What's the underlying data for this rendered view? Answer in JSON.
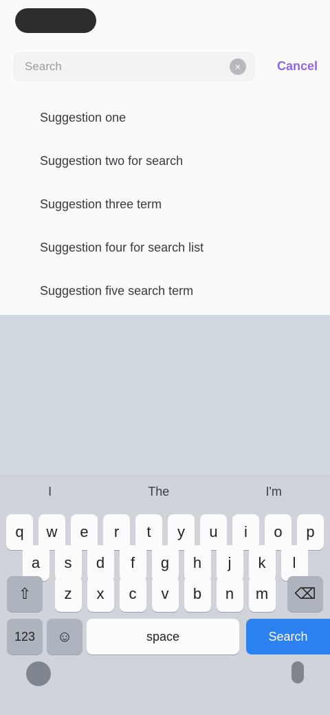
{
  "search": {
    "placeholder": "Search",
    "cancel_label": "Cancel"
  },
  "suggestions": [
    "Suggestion one",
    "Suggestion two for search",
    "Suggestion three term",
    "Suggestion four for search list",
    "Suggestion five search term"
  ],
  "keyboard": {
    "suggestions": [
      "I",
      "The",
      "I'm"
    ],
    "row1": [
      "q",
      "w",
      "e",
      "r",
      "t",
      "y",
      "u",
      "i",
      "o",
      "p"
    ],
    "row2": [
      "a",
      "s",
      "d",
      "f",
      "g",
      "h",
      "j",
      "k",
      "l"
    ],
    "row3": [
      "z",
      "x",
      "c",
      "v",
      "b",
      "n",
      "m"
    ],
    "shift_icon": "shift-icon",
    "backspace_icon": "backspace-icon",
    "number_key": "123",
    "emoji_key": "emoji-icon",
    "space_label": "space",
    "go_label": "Search"
  }
}
